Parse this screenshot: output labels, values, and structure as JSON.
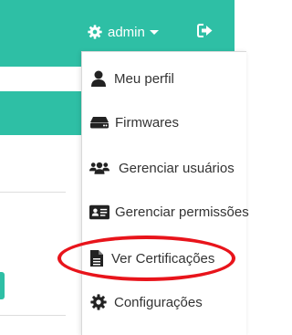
{
  "header": {
    "user_label": "admin",
    "accent_color": "#2ebfa5",
    "icons": [
      "gear-icon",
      "caret-down-icon",
      "logout-icon"
    ]
  },
  "user_menu": {
    "items": [
      {
        "label": "Meu perfil",
        "icon": "user-icon"
      },
      {
        "label": "Firmwares",
        "icon": "hard-drive-icon"
      },
      {
        "label": "Gerenciar usuários",
        "icon": "users-icon"
      },
      {
        "label": "Gerenciar permissões",
        "icon": "id-card-icon"
      },
      {
        "label": "Ver Certificações",
        "icon": "file-icon"
      },
      {
        "label": "Configurações",
        "icon": "gear-icon"
      }
    ],
    "highlighted_item": "Ver Certificações",
    "highlight_color": "#e8141b"
  }
}
